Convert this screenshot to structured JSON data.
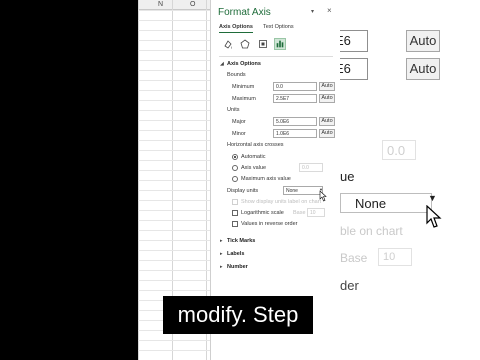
{
  "sheet": {
    "col_n": "N",
    "col_o": "O"
  },
  "background": {
    "row1_value": "E6",
    "row1_button": "Auto",
    "row2_value": "E6",
    "row2_button": "Auto",
    "ghost_value": "0.0",
    "partial_label": "ue",
    "dropdown_value": "None",
    "ghost_text_1": "ble on chart",
    "ghost_label": "Base",
    "ghost_input": "10",
    "partial_order": "der"
  },
  "pane": {
    "title": "Format Axis",
    "tabs": [
      "Axis Options",
      "Text Options"
    ],
    "section": "Axis Options",
    "bounds": {
      "heading": "Bounds",
      "minimum": {
        "label": "Minimum",
        "value": "0.0",
        "button": "Auto"
      },
      "maximum": {
        "label": "Maximum",
        "value": "2.5E7",
        "button": "Auto"
      }
    },
    "units": {
      "heading": "Units",
      "major": {
        "label": "Major",
        "value": "5.0E6",
        "button": "Auto"
      },
      "minor": {
        "label": "Minor",
        "value": "1.0E6",
        "button": "Auto"
      }
    },
    "crosses": {
      "heading": "Horizontal axis crosses",
      "automatic": "Automatic",
      "axis_value": "Axis value",
      "axis_value_input": "0.0",
      "maximum": "Maximum axis value"
    },
    "display_units": {
      "label": "Display units",
      "value": "None"
    },
    "show_label": "Show display units label on chart",
    "log": {
      "label": "Logarithmic scale",
      "base_label": "Base",
      "base_value": "10"
    },
    "reverse": "Values in reverse order",
    "collapsed": [
      "Tick Marks",
      "Labels",
      "Number"
    ]
  },
  "caption": "modify. Step",
  "colors": {
    "accent": "#1f6c3a",
    "selected_icon_bg": "#cfe6d6"
  },
  "icons": [
    "fill-line-icon",
    "effects-icon",
    "size-properties-icon",
    "axis-options-icon"
  ]
}
